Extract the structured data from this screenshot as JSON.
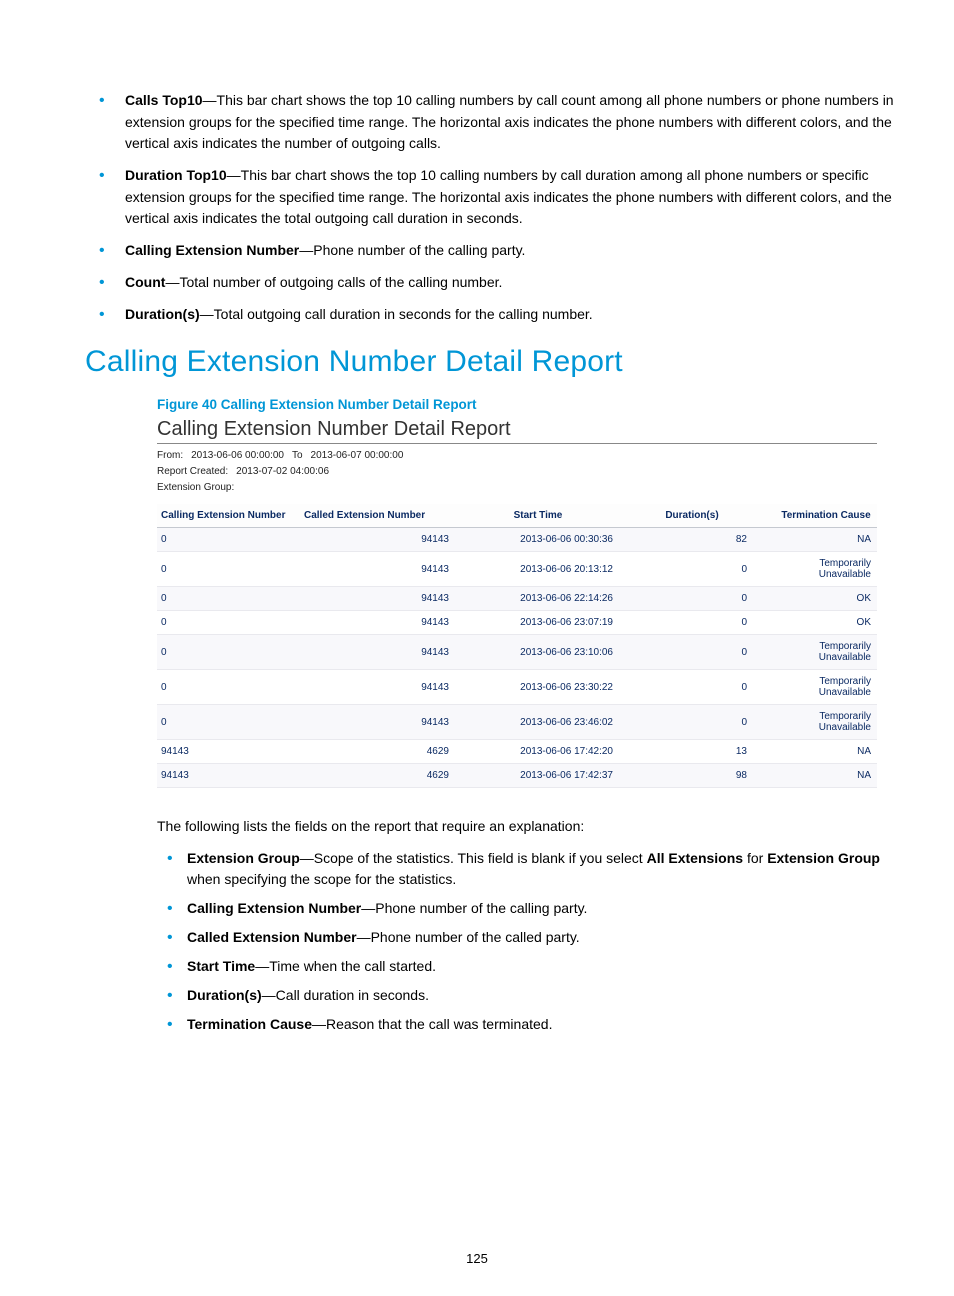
{
  "top_bullets": [
    {
      "term": "Calls Top10",
      "desc": "—This bar chart shows the top 10 calling numbers by call count among all phone numbers or phone numbers in extension groups for the specified time range. The horizontal axis indicates the phone numbers with different colors, and the vertical axis indicates the number of outgoing calls."
    },
    {
      "term": "Duration Top10",
      "desc": "—This bar chart shows the top 10 calling numbers by call duration among all phone numbers or specific extension groups for the specified time range. The horizontal axis indicates the phone numbers with different colors, and the vertical axis indicates the total outgoing call duration in seconds."
    },
    {
      "term": "Calling Extension Number",
      "desc": "—Phone number of the calling party."
    },
    {
      "term": "Count",
      "desc": "—Total number of outgoing calls of the calling number."
    },
    {
      "term": "Duration(s)",
      "desc": "—Total outgoing call duration in seconds for the calling number."
    }
  ],
  "section_title": "Calling Extension Number Detail Report",
  "figure_caption": "Figure 40 Calling Extension Number Detail Report",
  "report": {
    "title": "Calling Extension Number Detail Report",
    "meta": {
      "from_label": "From:",
      "from_value": "2013-06-06 00:00:00",
      "to_label": "To",
      "to_value": "2013-06-07 00:00:00",
      "created_label": "Report Created:",
      "created_value": "2013-07-02 04:00:06",
      "ext_group_label": "Extension Group:",
      "ext_group_value": ""
    },
    "columns": {
      "calling": "Calling Extension Number",
      "called": "Called Extension Number",
      "start": "Start Time",
      "duration": "Duration(s)",
      "termination": "Termination Cause"
    },
    "rows": [
      {
        "calling": "0",
        "called": "94143",
        "start": "2013-06-06 00:30:36",
        "duration": "82",
        "termination": "NA"
      },
      {
        "calling": "0",
        "called": "94143",
        "start": "2013-06-06 20:13:12",
        "duration": "0",
        "termination": "Temporarily Unavailable"
      },
      {
        "calling": "0",
        "called": "94143",
        "start": "2013-06-06 22:14:26",
        "duration": "0",
        "termination": "OK"
      },
      {
        "calling": "0",
        "called": "94143",
        "start": "2013-06-06 23:07:19",
        "duration": "0",
        "termination": "OK"
      },
      {
        "calling": "0",
        "called": "94143",
        "start": "2013-06-06 23:10:06",
        "duration": "0",
        "termination": "Temporarily Unavailable"
      },
      {
        "calling": "0",
        "called": "94143",
        "start": "2013-06-06 23:30:22",
        "duration": "0",
        "termination": "Temporarily Unavailable"
      },
      {
        "calling": "0",
        "called": "94143",
        "start": "2013-06-06 23:46:02",
        "duration": "0",
        "termination": "Temporarily Unavailable"
      },
      {
        "calling": "94143",
        "called": "4629",
        "start": "2013-06-06 17:42:20",
        "duration": "13",
        "termination": "NA"
      },
      {
        "calling": "94143",
        "called": "4629",
        "start": "2013-06-06 17:42:37",
        "duration": "98",
        "termination": "NA"
      }
    ]
  },
  "post_text": "The following lists the fields on the report that require an explanation:",
  "bottom_bullets": [
    {
      "term": "Extension Group",
      "desc_before": "—Scope of the statistics. This field is blank if you select ",
      "bold1": "All Extensions",
      "desc_mid": " for ",
      "bold2": "Extension Group",
      "desc_after": " when specifying the scope for the statistics."
    },
    {
      "term": "Calling Extension Number",
      "desc_before": "—Phone number of the calling party.",
      "bold1": "",
      "desc_mid": "",
      "bold2": "",
      "desc_after": ""
    },
    {
      "term": "Called Extension Number",
      "desc_before": "—Phone number of the called party.",
      "bold1": "",
      "desc_mid": "",
      "bold2": "",
      "desc_after": ""
    },
    {
      "term": "Start Time",
      "desc_before": "—Time when the call started.",
      "bold1": "",
      "desc_mid": "",
      "bold2": "",
      "desc_after": ""
    },
    {
      "term": "Duration(s)",
      "desc_before": "—Call duration in seconds.",
      "bold1": "",
      "desc_mid": "",
      "bold2": "",
      "desc_after": ""
    },
    {
      "term": "Termination Cause",
      "desc_before": "—Reason that the call was terminated.",
      "bold1": "",
      "desc_mid": "",
      "bold2": "",
      "desc_after": ""
    }
  ],
  "page_number": "125"
}
